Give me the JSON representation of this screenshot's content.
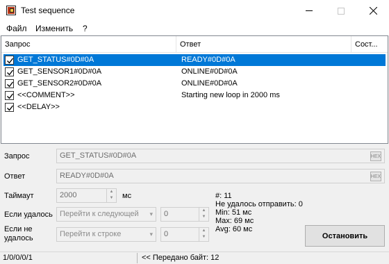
{
  "window": {
    "title": "Test sequence"
  },
  "menu": [
    "Файл",
    "Изменить",
    "?"
  ],
  "list": {
    "columns": [
      "Запрос",
      "Ответ",
      "Сост..."
    ],
    "rows": [
      {
        "checked": true,
        "request": "GET_STATUS#0D#0A",
        "response": "READY#0D#0A",
        "selected": true
      },
      {
        "checked": true,
        "request": "GET_SENSOR1#0D#0A",
        "response": "ONLINE#0D#0A",
        "selected": false
      },
      {
        "checked": true,
        "request": "GET_SENSOR2#0D#0A",
        "response": "ONLINE#0D#0A",
        "selected": false
      },
      {
        "checked": true,
        "request": "<<COMMENT>>",
        "response": "Starting new loop in 2000 ms",
        "selected": false
      },
      {
        "checked": true,
        "request": "<<DELAY>>",
        "response": "",
        "selected": false
      }
    ]
  },
  "form": {
    "request_label": "Запрос",
    "request_value": "GET_STATUS#0D#0A",
    "response_label": "Ответ",
    "response_value": "READY#0D#0A",
    "timeout_label": "Таймаут",
    "timeout_value": "2000",
    "timeout_unit": "мс",
    "on_success_label": "Если удалось",
    "on_success_action": "Перейти к следующей",
    "on_success_number": "0",
    "on_fail_label_1": "Если не",
    "on_fail_label_2": "удалось",
    "on_fail_action": "Перейти к строке",
    "on_fail_number": "0",
    "hex_icon": "hex-edit-icon"
  },
  "stats": {
    "count": "#: 11",
    "failed": "Не удалось отправить: 0",
    "min": "Min: 51 мс",
    "max": "Max: 69 мс",
    "avg": "Avg: 60 мс"
  },
  "buttons": {
    "stop": "Остановить"
  },
  "status": {
    "counters": "1/0/0/0/1",
    "bytes_sent": "<< Передано байт: 12"
  },
  "colors": {
    "selection": "#0078d7"
  }
}
